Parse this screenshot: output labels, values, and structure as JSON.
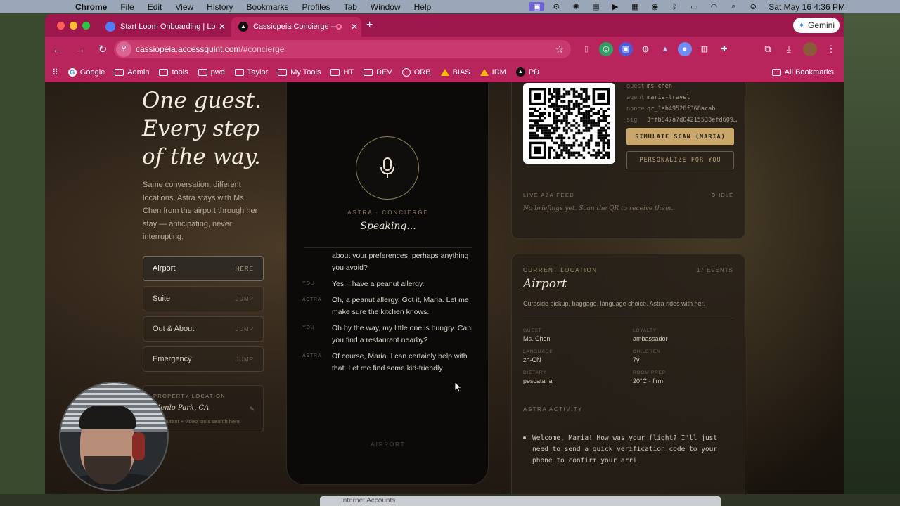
{
  "menubar": {
    "app": "Chrome",
    "items": [
      "File",
      "Edit",
      "View",
      "History",
      "Bookmarks",
      "Profiles",
      "Tab",
      "Window",
      "Help"
    ],
    "clock": "Sat May 16  4:36 PM"
  },
  "browser": {
    "tabs": [
      {
        "label": "Start Loom Onboarding | Loo"
      },
      {
        "label": "Cassiopeia Concierge — V"
      }
    ],
    "gemini": "Gemini",
    "url_host": "cassiopeia.accessquint.com",
    "url_path": "/#concierge",
    "bookmarks": [
      {
        "label": "Google",
        "icon": "google-icon"
      },
      {
        "label": "Admin",
        "icon": "folder-icon"
      },
      {
        "label": "tools",
        "icon": "folder-icon"
      },
      {
        "label": "pwd",
        "icon": "folder-icon"
      },
      {
        "label": "Taylor",
        "icon": "folder-icon"
      },
      {
        "label": "My Tools",
        "icon": "folder-icon"
      },
      {
        "label": "HT",
        "icon": "folder-icon"
      },
      {
        "label": "DEV",
        "icon": "folder-icon"
      },
      {
        "label": "ORB",
        "icon": "globe-icon"
      },
      {
        "label": "BIAS",
        "icon": "drive-icon"
      },
      {
        "label": "IDM",
        "icon": "drive-icon"
      },
      {
        "label": "PD",
        "icon": "app-icon"
      }
    ],
    "all_bookmarks": "All Bookmarks"
  },
  "hero": {
    "title": "One guest. Every step of the way.",
    "description": "Same conversation, different locations. Astra stays with Ms. Chen from the airport through her stay — anticipating, never interrupting."
  },
  "nav": [
    {
      "label": "Airport",
      "tag": "HERE"
    },
    {
      "label": "Suite",
      "tag": "JUMP"
    },
    {
      "label": "Out & About",
      "tag": "JUMP"
    },
    {
      "label": "Emergency",
      "tag": "JUMP"
    }
  ],
  "property": {
    "label": "PROPERTY LOCATION",
    "value": "Menlo Park, CA",
    "note": "Restaurant + video tools search here."
  },
  "phone": {
    "agent_label": "ASTRA · CONCIERGE",
    "status": "Speaking...",
    "footer": "AIRPORT",
    "messages": [
      {
        "who": "",
        "text": "about your preferences, perhaps anything you avoid?"
      },
      {
        "who": "YOU",
        "text": "Yes, I have a peanut allergy."
      },
      {
        "who": "ASTRA",
        "text": "Oh, a peanut allergy. Got it, Maria. Let me make sure the kitchen knows."
      },
      {
        "who": "YOU",
        "text": "Oh by the way, my little one is hungry. Can you find a restaurant nearby?"
      },
      {
        "who": "ASTRA",
        "text": "Of course, Maria. I can certainly help with that. Let me find some kid-friendly"
      }
    ]
  },
  "qr_card": {
    "guest_key": "guest",
    "guest_val": "ms-chen",
    "agent_key": "agent",
    "agent_val": "maria-travel",
    "nonce_key": "nonce",
    "nonce_val": "qr_1ab49528f368acab",
    "sig_key": "sig",
    "sig_val": "3ffb847a7d04215533efd609…",
    "simulate_btn": "SIMULATE SCAN (MARIA)",
    "personalize_btn": "PERSONALIZE FOR YOU",
    "feed_label": "LIVE A2A FEED",
    "feed_status": "IDLE",
    "feed_empty": "No briefings yet. Scan the QR to receive them."
  },
  "location": {
    "label": "CURRENT LOCATION",
    "events": "17 EVENTS",
    "name": "Airport",
    "desc": "Curbside pickup, baggage, language choice. Astra rides with her.",
    "fields": [
      {
        "label": "GUEST",
        "value": "Ms. Chen"
      },
      {
        "label": "LOYALTY",
        "value": "ambassador"
      },
      {
        "label": "LANGUAGE",
        "value": "zh-CN"
      },
      {
        "label": "CHILDREN",
        "value": "7y"
      },
      {
        "label": "DIETARY",
        "value": "pescatarian"
      },
      {
        "label": "ROOM PREP",
        "value": "20°C · firm"
      }
    ],
    "activity_label": "ASTRA ACTIVITY",
    "activity": "Welcome, Maria! How was your flight? I'll just need to send a quick verification code to your phone to confirm your arri"
  },
  "dock_hint": "Internet Accounts"
}
